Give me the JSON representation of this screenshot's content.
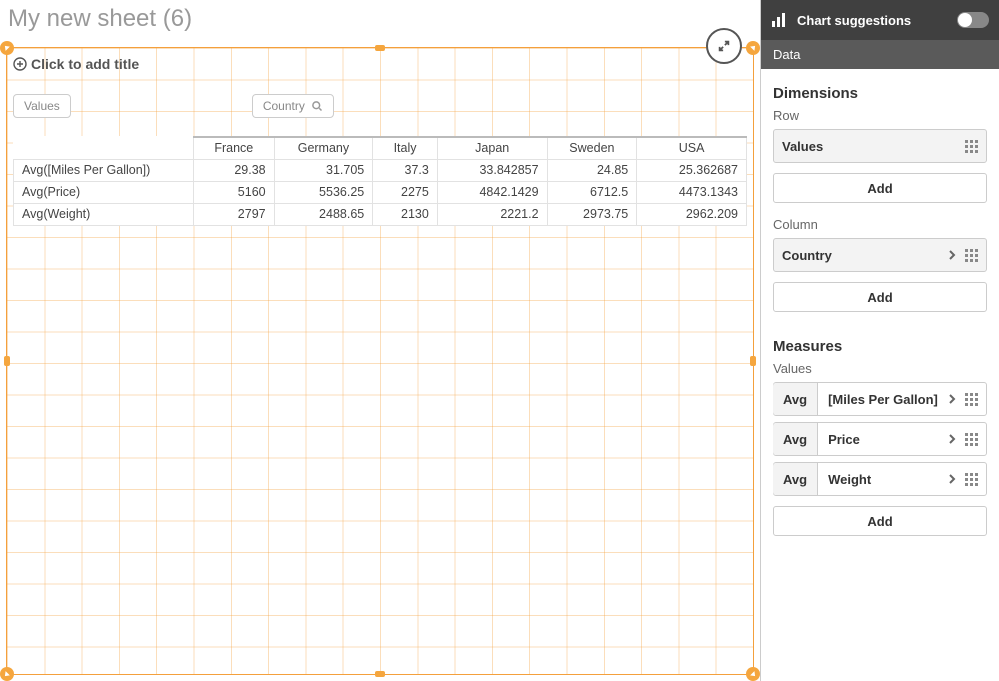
{
  "sheet": {
    "title": "My new sheet (6)",
    "title_placeholder": "Click to add title",
    "chips": {
      "values": "Values",
      "country": "Country"
    }
  },
  "table": {
    "columns": [
      "France",
      "Germany",
      "Italy",
      "Japan",
      "Sweden",
      "USA"
    ],
    "rows": [
      {
        "label": "Avg([Miles Per Gallon])",
        "values": [
          "29.38",
          "31.705",
          "37.3",
          "33.842857",
          "24.85",
          "25.362687"
        ]
      },
      {
        "label": "Avg(Price)",
        "values": [
          "5160",
          "5536.25",
          "2275",
          "4842.1429",
          "6712.5",
          "4473.1343"
        ]
      },
      {
        "label": "Avg(Weight)",
        "values": [
          "2797",
          "2488.65",
          "2130",
          "2221.2",
          "2973.75",
          "2962.209"
        ]
      }
    ]
  },
  "panel": {
    "head": "Chart suggestions",
    "data_label": "Data",
    "dimensions": {
      "title": "Dimensions",
      "row_label": "Row",
      "row_item": "Values",
      "column_label": "Column",
      "column_item": "Country",
      "add": "Add"
    },
    "measures": {
      "title": "Measures",
      "sub": "Values",
      "agg": "Avg",
      "items": [
        "[Miles Per Gallon]",
        "Price",
        "Weight"
      ],
      "add": "Add"
    }
  },
  "chart_data": {
    "type": "table",
    "row_dimension": "Values",
    "column_dimension": "Country",
    "columns": [
      "France",
      "Germany",
      "Italy",
      "Japan",
      "Sweden",
      "USA"
    ],
    "series": [
      {
        "name": "Avg([Miles Per Gallon])",
        "values": [
          29.38,
          31.705,
          37.3,
          33.842857,
          24.85,
          25.362687
        ]
      },
      {
        "name": "Avg(Price)",
        "values": [
          5160,
          5536.25,
          2275,
          4842.1429,
          6712.5,
          4473.1343
        ]
      },
      {
        "name": "Avg(Weight)",
        "values": [
          2797,
          2488.65,
          2130,
          2221.2,
          2973.75,
          2962.209
        ]
      }
    ]
  }
}
